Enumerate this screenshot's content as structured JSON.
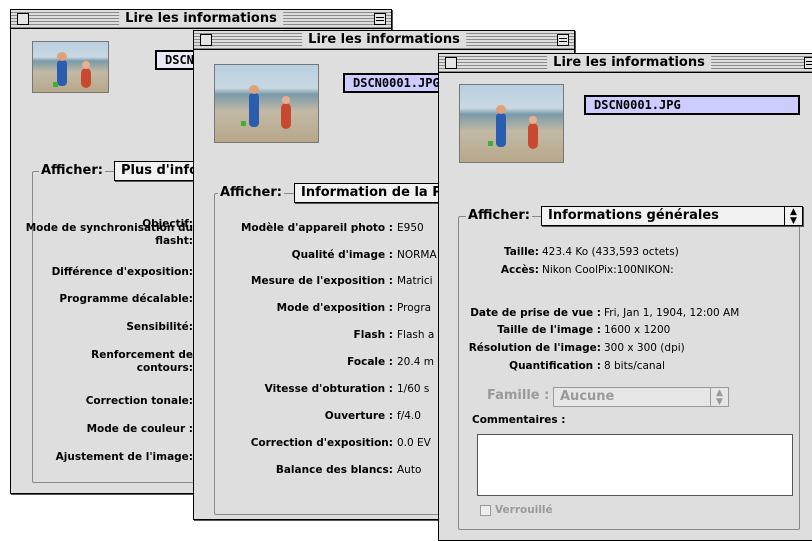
{
  "window_title": "Lire les informations",
  "file_name": "DSCN0001.JPG",
  "afficher_label": "Afficher:",
  "win1": {
    "file_name_clip": "DSCN",
    "popup_value": "Plus d'info",
    "labels": [
      "Objectif:",
      "Mode de synchronisation du flasht:",
      "Différence d'exposition:",
      "Programme décalable:",
      "Sensibilité:",
      "Renforcement de contours:",
      "Correction tonale:",
      "Mode de couleur :",
      "Ajustement de l'image:"
    ]
  },
  "win2": {
    "file_name_clip": "DSCN0001.JPG",
    "popup_value": "Information de la P",
    "rows": [
      {
        "label": "Modèle d'appareil photo",
        "value": "E950"
      },
      {
        "label": "Qualité d'image",
        "value": "NORMA"
      },
      {
        "label": "Mesure de l'exposition",
        "value": "Matrici"
      },
      {
        "label": "Mode d'exposition",
        "value": "Progra"
      },
      {
        "label": "Flash",
        "value": "Flash a"
      },
      {
        "label": "Focale",
        "value": "20.4 m"
      },
      {
        "label": "Vitesse d'obturation",
        "value": "1/60 s"
      },
      {
        "label": "Ouverture",
        "value": "f/4.0"
      },
      {
        "label": "Correction d'exposition",
        "value": "0.0 EV"
      },
      {
        "label": "Balance des blancs",
        "value": "Auto"
      }
    ]
  },
  "win3": {
    "popup_value": "Informations générales",
    "taille_label": "Taille:",
    "taille_value": "423.4 Ko (433,593 octets)",
    "acces_label": "Accès:",
    "acces_value": "Nikon CoolPix:100NIKON:",
    "date_label": "Date de prise de vue :",
    "date_value": "Fri, Jan 1, 1904, 12:00 AM",
    "image_size_label": "Taille de l'image :",
    "image_size_value": "1600 x 1200",
    "resolution_label": "Résolution de l'image:",
    "resolution_value": "300 x 300 (dpi)",
    "quant_label": "Quantification :",
    "quant_value": "8 bits/canal",
    "famille_label": "Famille :",
    "famille_value": "Aucune",
    "comments_label": "Commentaires :",
    "comments_value": "",
    "lock_label": "Verrouillé"
  }
}
